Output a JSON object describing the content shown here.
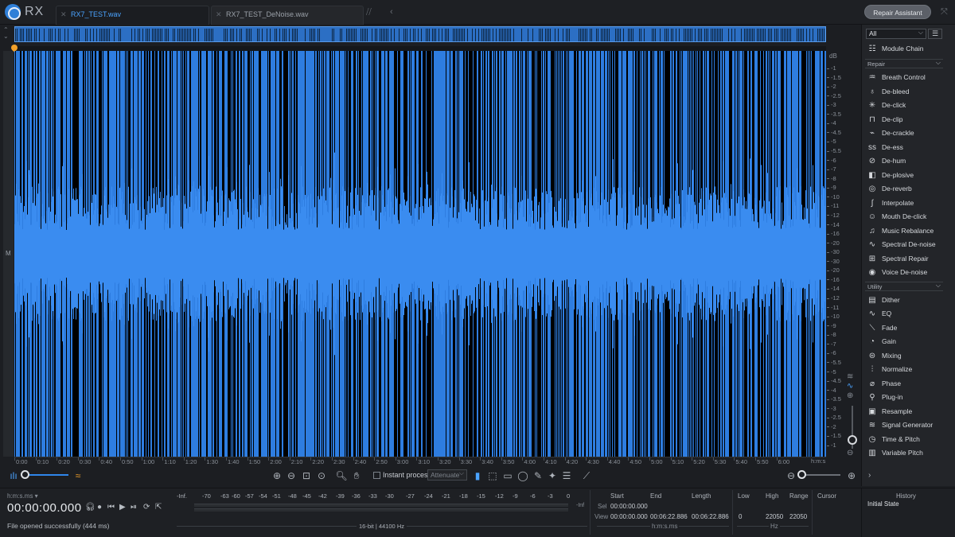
{
  "app": {
    "name": "RX"
  },
  "tabs": [
    {
      "label": "RX7_TEST.wav",
      "active": true
    },
    {
      "label": "RX7_TEST_DeNoise.wav",
      "active": false
    }
  ],
  "repair_assistant_label": "Repair Assistant",
  "track": {
    "channel_label": "M"
  },
  "db_scale": {
    "unit": "dB",
    "ticks": [
      "-1",
      "-1.5",
      "-2",
      "-2.5",
      "-3",
      "-3.5",
      "-4",
      "-4.5",
      "-5",
      "-5.5",
      "-6",
      "-7",
      "-8",
      "-9",
      "-10",
      "-11",
      "-12",
      "-14",
      "-16",
      "-20",
      "-30",
      "-30",
      "-20",
      "-16",
      "-14",
      "-12",
      "-11",
      "-10",
      "-9",
      "-8",
      "-7",
      "-6",
      "-5.5",
      "-5",
      "-4.5",
      "-4",
      "-3.5",
      "-3",
      "-2.5",
      "-2",
      "-1.5",
      "-1"
    ]
  },
  "time_ruler": {
    "labels": [
      "0:00",
      "0:10",
      "0:20",
      "0:30",
      "0:40",
      "0:50",
      "1:00",
      "1:10",
      "1:20",
      "1:30",
      "1:40",
      "1:50",
      "2:00",
      "2:10",
      "2:20",
      "2:30",
      "2:40",
      "2:50",
      "3:00",
      "3:10",
      "3:20",
      "3:30",
      "3:40",
      "3:50",
      "4:00",
      "4:10",
      "4:20",
      "4:30",
      "4:40",
      "4:50",
      "5:00",
      "5:10",
      "5:20",
      "5:30",
      "5:40",
      "5:50",
      "6:00"
    ],
    "unit": "h:m:s"
  },
  "toolbar": {
    "instant_process_label": "Instant process",
    "attenuate_value": "Attenuate",
    "instant_process_checked": false
  },
  "transport": {
    "time_format": "h:m:s.ms",
    "timecode": "00:00:00.000",
    "status": "File opened successfully (444 ms)"
  },
  "meter": {
    "labels": [
      "-Inf.",
      "-70",
      "-63",
      "-60",
      "-57",
      "-54",
      "-51",
      "-48",
      "-45",
      "-42",
      "-39",
      "-36",
      "-33",
      "-30",
      "-27",
      "-24",
      "-21",
      "-18",
      "-15",
      "-12",
      "-9",
      "-6",
      "-3",
      "0"
    ],
    "inf_right": "-Inf",
    "bit_info": "16-bit | 44100 Hz"
  },
  "selection": {
    "headers": {
      "start": "Start",
      "end": "End",
      "length": "Length",
      "low": "Low",
      "high": "High",
      "range": "Range",
      "cursor": "Cursor"
    },
    "sel_label": "Sel",
    "view_label": "View",
    "sel": {
      "start": "00:00:00.000"
    },
    "view": {
      "start": "00:00:00.000",
      "end": "00:06:22.886",
      "length": "00:06:22.886",
      "low": "0",
      "high": "22050",
      "range": "22050"
    },
    "sel_end": "00:06:22.886",
    "sel_length": "00:06:22.886",
    "time_unit": "h:m:s.ms",
    "freq_unit": "Hz"
  },
  "module_panel": {
    "filter_value": "All",
    "module_chain_label": "Module Chain",
    "sections": [
      {
        "label": "Repair",
        "items": [
          "Breath Control",
          "De-bleed",
          "De-click",
          "De-clip",
          "De-crackle",
          "De-ess",
          "De-hum",
          "De-plosive",
          "De-reverb",
          "Interpolate",
          "Mouth De-click",
          "Music Rebalance",
          "Spectral De-noise",
          "Spectral Repair",
          "Voice De-noise"
        ]
      },
      {
        "label": "Utility",
        "items": [
          "Dither",
          "EQ",
          "Fade",
          "Gain",
          "Mixing",
          "Normalize",
          "Phase",
          "Plug-in",
          "Resample",
          "Signal Generator",
          "Time & Pitch",
          "Variable Pitch"
        ]
      }
    ]
  },
  "history": {
    "title": "History",
    "items": [
      "Initial State"
    ]
  },
  "colors": {
    "accent": "#3384e8",
    "waveform_bg": "#000000",
    "tab_active": "#4aa3ff",
    "playhead": "#f1a02a"
  }
}
